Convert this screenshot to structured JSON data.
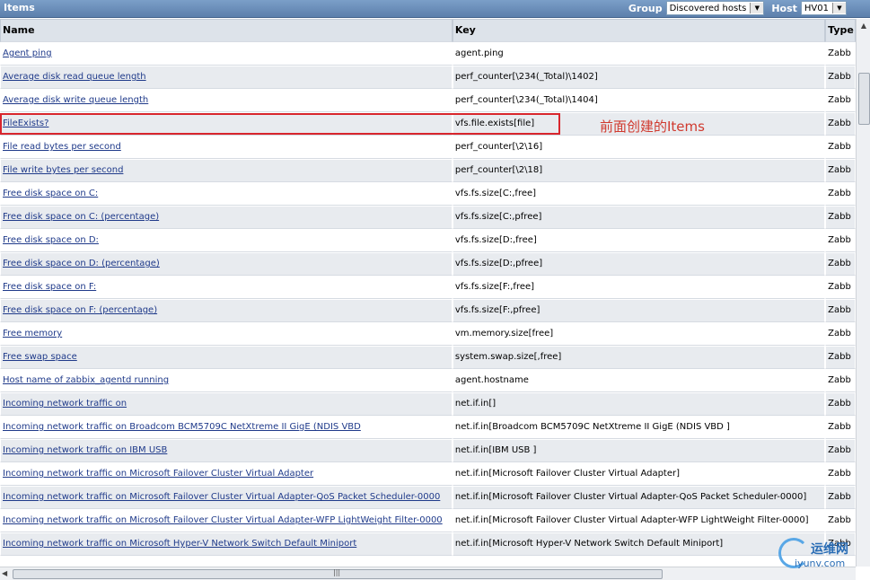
{
  "header": {
    "title": "Items",
    "group_label": "Group",
    "group_value": "Discovered hosts",
    "host_label": "Host",
    "host_value": "HV01"
  },
  "table": {
    "columns": [
      "Name",
      "Key",
      "Type"
    ],
    "rows": [
      {
        "name": "Agent ping",
        "key": "agent.ping",
        "type": "Zabb"
      },
      {
        "name": "Average disk read queue length",
        "key": "perf_counter[\\234(_Total)\\1402]",
        "type": "Zabb"
      },
      {
        "name": "Average disk write queue length",
        "key": "perf_counter[\\234(_Total)\\1404]",
        "type": "Zabb"
      },
      {
        "name": "FileExists?",
        "key": "vfs.file.exists[file]",
        "type": "Zabb"
      },
      {
        "name": "File read bytes per second",
        "key": "perf_counter[\\2\\16]",
        "type": "Zabb"
      },
      {
        "name": "File write bytes per second",
        "key": "perf_counter[\\2\\18]",
        "type": "Zabb"
      },
      {
        "name": "Free disk space on C:",
        "key": "vfs.fs.size[C:,free]",
        "type": "Zabb"
      },
      {
        "name": "Free disk space on C: (percentage)",
        "key": "vfs.fs.size[C:,pfree]",
        "type": "Zabb"
      },
      {
        "name": "Free disk space on D:",
        "key": "vfs.fs.size[D:,free]",
        "type": "Zabb"
      },
      {
        "name": "Free disk space on D: (percentage)",
        "key": "vfs.fs.size[D:,pfree]",
        "type": "Zabb"
      },
      {
        "name": "Free disk space on F:",
        "key": "vfs.fs.size[F:,free]",
        "type": "Zabb"
      },
      {
        "name": "Free disk space on F: (percentage)",
        "key": "vfs.fs.size[F:,pfree]",
        "type": "Zabb"
      },
      {
        "name": "Free memory",
        "key": "vm.memory.size[free]",
        "type": "Zabb"
      },
      {
        "name": "Free swap space",
        "key": "system.swap.size[,free]",
        "type": "Zabb"
      },
      {
        "name": "Host name of zabbix_agentd running",
        "key": "agent.hostname",
        "type": "Zabb"
      },
      {
        "name": "Incoming network traffic on",
        "key": "net.if.in[]",
        "type": "Zabb"
      },
      {
        "name": "Incoming network traffic on Broadcom BCM5709C NetXtreme II GigE (NDIS VBD",
        "key": "net.if.in[Broadcom BCM5709C NetXtreme II GigE (NDIS VBD ]",
        "type": "Zabb"
      },
      {
        "name": "Incoming network traffic on IBM USB",
        "key": "net.if.in[IBM USB ]",
        "type": "Zabb"
      },
      {
        "name": "Incoming network traffic on Microsoft Failover Cluster Virtual Adapter",
        "key": "net.if.in[Microsoft Failover Cluster Virtual Adapter]",
        "type": "Zabb"
      },
      {
        "name": "Incoming network traffic on Microsoft Failover Cluster Virtual Adapter-QoS Packet Scheduler-0000",
        "key": "net.if.in[Microsoft Failover Cluster Virtual Adapter-QoS Packet Scheduler-0000]",
        "type": "Zabb"
      },
      {
        "name": "Incoming network traffic on Microsoft Failover Cluster Virtual Adapter-WFP LightWeight Filter-0000",
        "key": "net.if.in[Microsoft Failover Cluster Virtual Adapter-WFP LightWeight Filter-0000]",
        "type": "Zabb"
      },
      {
        "name": "Incoming network traffic on Microsoft Hyper-V Network Switch Default Miniport",
        "key": "net.if.in[Microsoft Hyper-V Network Switch Default Miniport]",
        "type": "Zabb"
      }
    ]
  },
  "annotation": {
    "text": "前面创建的Items",
    "color": "#d8262d"
  },
  "watermark": {
    "line1": "运维网",
    "line2": "iyunv.com"
  }
}
